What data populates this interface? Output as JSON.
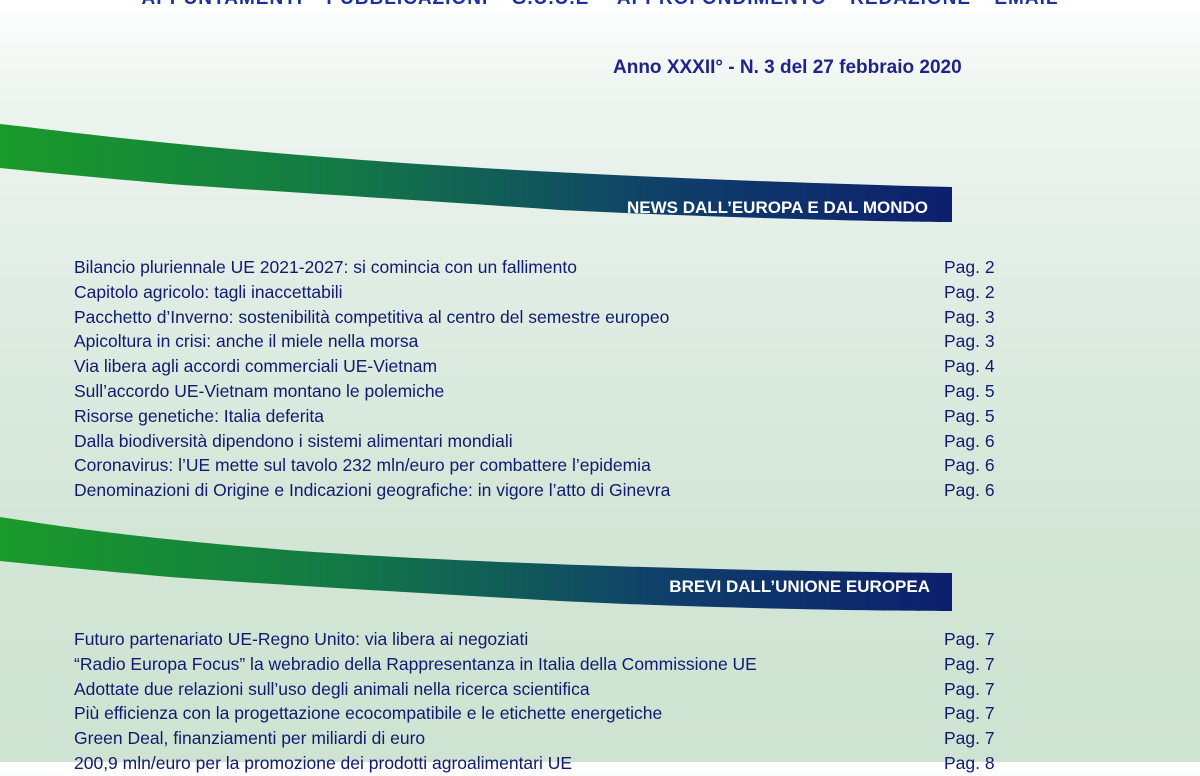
{
  "header": {
    "nav": [
      "APPUNTAMENTI",
      "PUBBLICAZIONI",
      "G.U.U.E",
      "APPROFONDIMENTO",
      "REDAZIONE",
      "EMAIL"
    ],
    "nav_separators": [
      "-",
      "-",
      "–",
      "-",
      "-"
    ],
    "issue": "Anno XXXII° - N. 3 del 27 febbraio 2020"
  },
  "sections": [
    {
      "title": "NEWS DALL’EUROPA E DAL MONDO",
      "items": [
        {
          "title": "Bilancio pluriennale UE 2021-2027: si comincia con un fallimento",
          "page": "Pag. 2"
        },
        {
          "title": "Capitolo agricolo: tagli inaccettabili",
          "page": "Pag. 2"
        },
        {
          "title": "Pacchetto d’Inverno: sostenibilità competitiva al centro del semestre europeo",
          "page": "Pag. 3"
        },
        {
          "title": "Apicoltura in crisi: anche il miele nella morsa",
          "page": "Pag. 3"
        },
        {
          "title": "Via libera agli accordi commerciali UE-Vietnam",
          "page": "Pag. 4"
        },
        {
          "title": "Sull’accordo UE-Vietnam montano le polemiche",
          "page": "Pag. 5"
        },
        {
          "title": "Risorse genetiche: Italia deferita",
          "page": "Pag. 5"
        },
        {
          "title": "Dalla biodiversità dipendono i sistemi alimentari mondiali",
          "page": "Pag. 6"
        },
        {
          "title": "Coronavirus: l’UE mette sul tavolo 232 mln/euro per combattere l’epidemia",
          "page": "Pag. 6"
        },
        {
          "title": "Denominazioni di Origine e Indicazioni geografiche: in vigore l’atto di Ginevra",
          "page": "Pag. 6"
        }
      ]
    },
    {
      "title": "BREVI DALL’UNIONE EUROPEA",
      "items": [
        {
          "title": "Futuro partenariato UE-Regno Unito: via libera ai negoziati",
          "page": "Pag. 7"
        },
        {
          "title": "“Radio Europa Focus” la webradio della Rappresentanza in Italia della Commissione UE",
          "page": "Pag. 7"
        },
        {
          "title": "Adottate due relazioni sull’uso degli animali nella ricerca scientifica",
          "page": "Pag. 7"
        },
        {
          "title": "Più efficienza con la progettazione ecocompatibile e le etichette energetiche",
          "page": "Pag. 7"
        },
        {
          "title": "Green Deal, finanziamenti per miliardi di euro",
          "page": "Pag. 7"
        },
        {
          "title": "200,9 mln/euro per la promozione dei prodotti agroalimentari UE",
          "page": "Pag. 8"
        }
      ]
    }
  ],
  "colors": {
    "nav": "#1e2fa0",
    "text": "#101a70",
    "swoosh_green": "#1a9a2a",
    "swoosh_navy": "#0d1f6e"
  }
}
